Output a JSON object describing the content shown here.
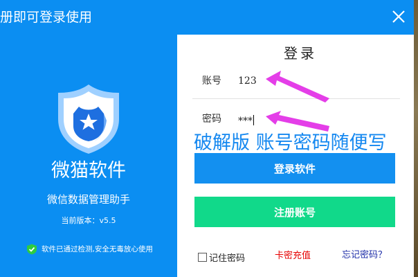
{
  "window": {
    "title": "册即可登录使用"
  },
  "left": {
    "app_name": "微猫软件",
    "subtitle": "微信数据管理助手",
    "version_label": "当前版本：",
    "version_value": "v5.5",
    "safe_text": "软件已通过检测,安全无毒放心使用"
  },
  "form": {
    "heading": "登录",
    "account_label": "账号",
    "account_value": "123",
    "password_label": "密码",
    "password_value": "***",
    "overlay_text": "破解版 账号密码随便写",
    "login_button": "登录软件",
    "register_button": "注册账号",
    "remember_label": "记住密码",
    "recharge_link": "卡密充值",
    "forgot_link": "忘记密码？"
  },
  "colors": {
    "brand_blue": "#0b8ef2",
    "register_green": "#11d98a",
    "arrow_magenta": "#e43ee8",
    "recharge_red": "#e60000"
  }
}
